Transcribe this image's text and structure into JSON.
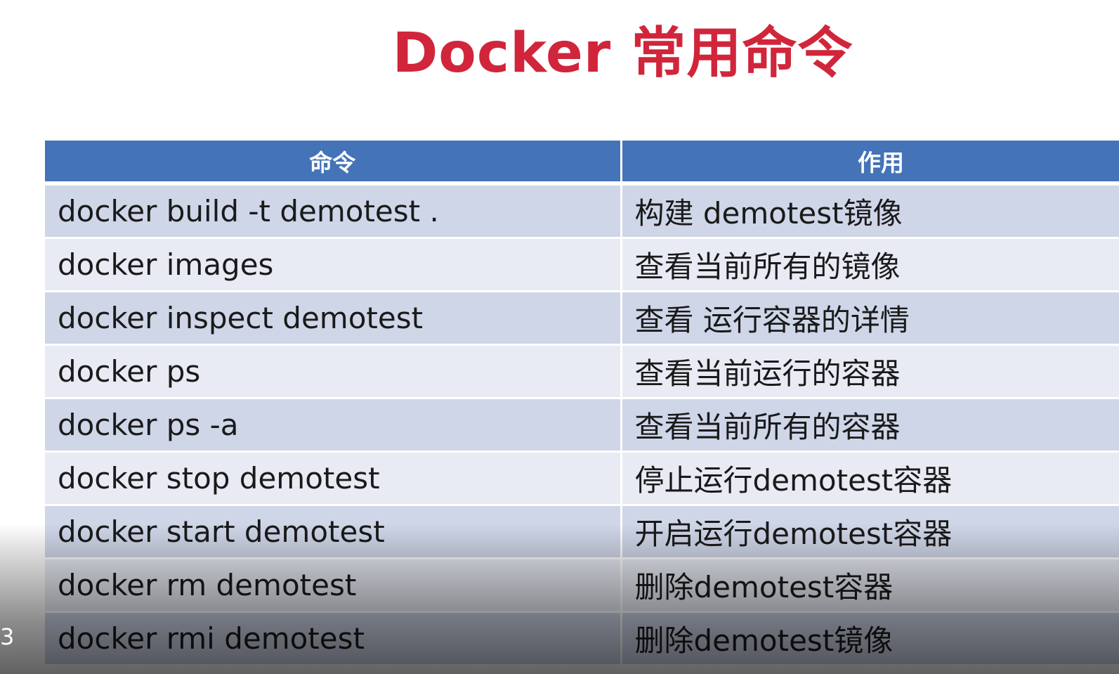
{
  "slide": {
    "title": "Docker 常用命令",
    "page_indicator": "3"
  },
  "table": {
    "headers": [
      "命令",
      "作用"
    ],
    "rows": [
      {
        "command": "docker build -t demotest .",
        "effect": "构建 demotest镜像"
      },
      {
        "command": "docker images",
        "effect": "查看当前所有的镜像"
      },
      {
        "command": "docker inspect demotest",
        "effect": "查看 运行容器的详情"
      },
      {
        "command": "docker ps",
        "effect": "查看当前运行的容器"
      },
      {
        "command": "docker ps -a",
        "effect": "查看当前所有的容器"
      },
      {
        "command": "docker stop demotest",
        "effect": "停止运行demotest容器"
      },
      {
        "command": "docker start demotest",
        "effect": "开启运行demotest容器"
      },
      {
        "command": "docker rm demotest",
        "effect": "删除demotest容器"
      },
      {
        "command": "docker rmi demotest",
        "effect": "删除demotest镜像"
      }
    ]
  },
  "colors": {
    "title": "#d1253b",
    "header_bg": "#4473b8",
    "row_even": "#cfd6e8",
    "row_odd": "#e8ebf4"
  }
}
